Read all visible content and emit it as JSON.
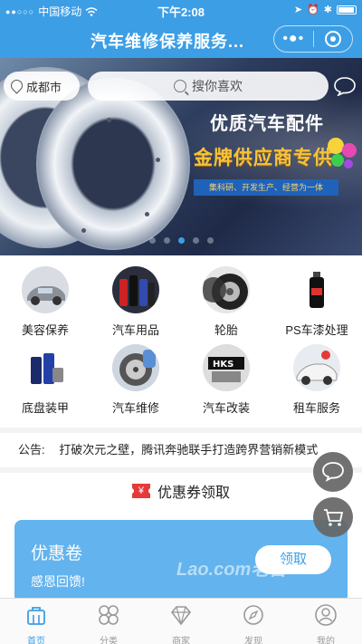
{
  "status_bar": {
    "carrier": "中国移动",
    "time": "下午2:08"
  },
  "nav": {
    "title": "汽车维修保养服务...",
    "more_icon": "ellipsis-icon",
    "close_icon": "target-icon"
  },
  "banner": {
    "line1": "优质汽车配件",
    "line2": "金牌供应商专供",
    "ribbon": "集科研、开发生产、经营为一体",
    "slides": 5,
    "active_slide": 3
  },
  "search": {
    "city": "成都市",
    "placeholder": "搜你喜欢"
  },
  "categories": [
    {
      "label": "美容保养",
      "icon": "car-beauty-icon"
    },
    {
      "label": "汽车用品",
      "icon": "car-products-icon"
    },
    {
      "label": "轮胎",
      "icon": "tire-icon"
    },
    {
      "label": "PS车漆处理",
      "icon": "paint-icon"
    },
    {
      "label": "底盘装甲",
      "icon": "chassis-icon"
    },
    {
      "label": "汽车维修",
      "icon": "repair-icon"
    },
    {
      "label": "汽车改装",
      "icon": "modify-icon"
    },
    {
      "label": "租车服务",
      "icon": "rental-icon"
    }
  ],
  "notice": {
    "label": "公告:",
    "text": "打破次元之壁，腾讯奔驰联手打造跨界营销新模式"
  },
  "coupon": {
    "section_title": "优惠券领取",
    "card_title": "优惠卷",
    "card_sub": "感恩回馈!",
    "button": "领取"
  },
  "watermark": "Lao.com老吾",
  "tabs": [
    {
      "label": "首页",
      "icon": "home-icon",
      "active": true
    },
    {
      "label": "分类",
      "icon": "category-icon",
      "active": false
    },
    {
      "label": "商家",
      "icon": "diamond-icon",
      "active": false
    },
    {
      "label": "发现",
      "icon": "compass-icon",
      "active": false
    },
    {
      "label": "我的",
      "icon": "user-icon",
      "active": false
    }
  ],
  "colors": {
    "primary": "#3c9ee5",
    "coupon_card": "#63b3ee",
    "coupon_badge": "#e43a3a"
  }
}
